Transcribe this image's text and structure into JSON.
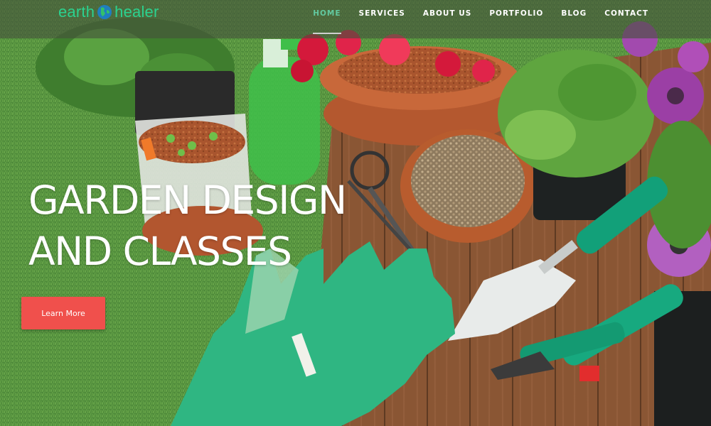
{
  "brand": {
    "logo_left": "earth",
    "logo_right": "healer",
    "logo_color": "#2bd28f"
  },
  "nav": {
    "items": [
      {
        "label": "HOME",
        "active": true
      },
      {
        "label": "SERVICES",
        "active": false
      },
      {
        "label": "ABOUT US",
        "active": false
      },
      {
        "label": "PORTFOLIO",
        "active": false
      },
      {
        "label": "BLOG",
        "active": false
      },
      {
        "label": "CONTACT",
        "active": false
      }
    ],
    "active_color": "#62c9a0"
  },
  "hero": {
    "title_line1": "GARDEN DESIGN",
    "title_line2": "AND CLASSES",
    "cta_label": "Learn More",
    "cta_color": "#f0504c"
  }
}
